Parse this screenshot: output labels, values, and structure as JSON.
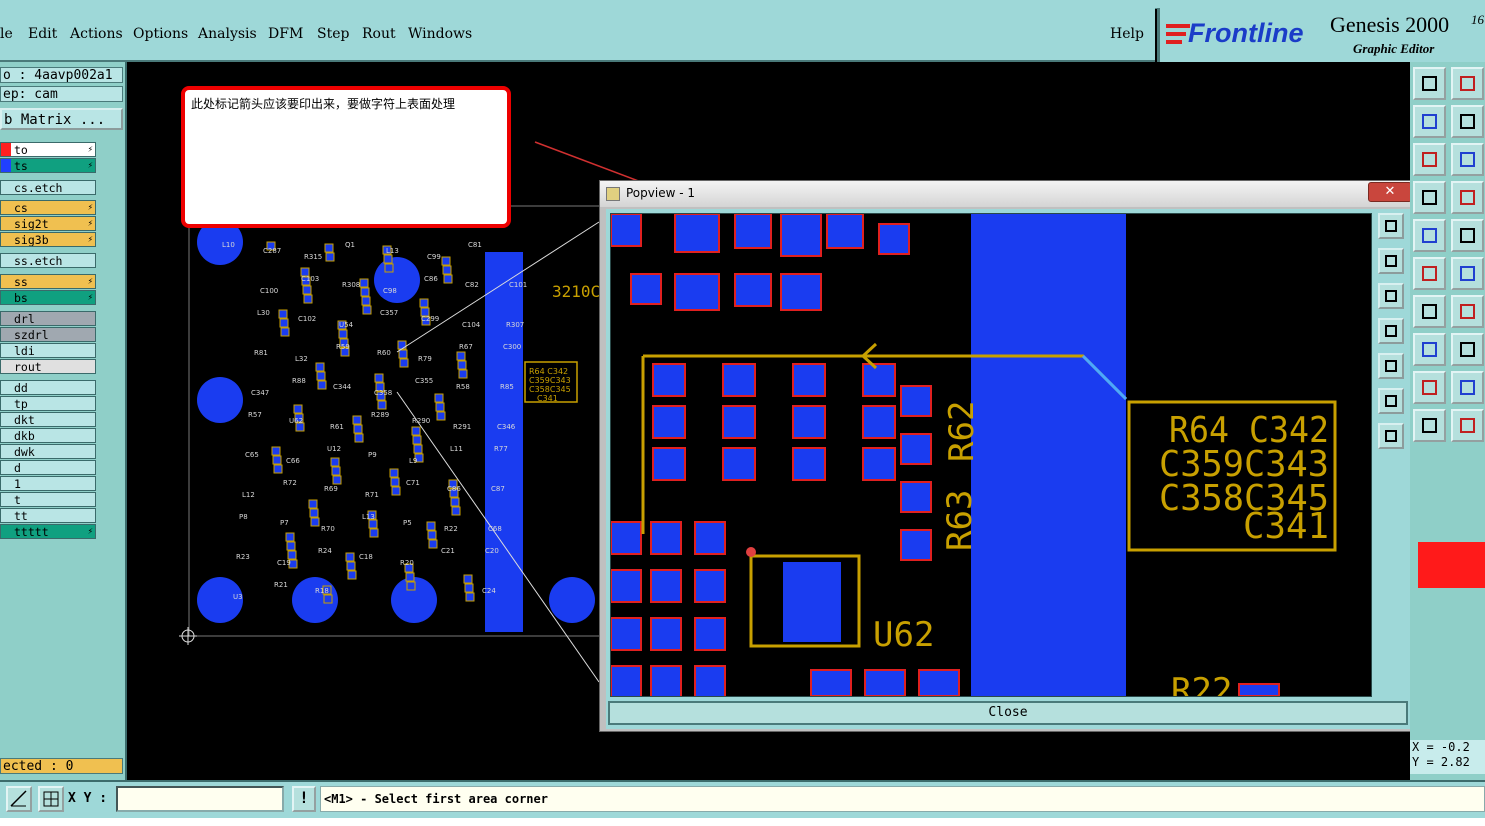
{
  "menu": {
    "items": [
      "le",
      "Edit",
      "Actions",
      "Options",
      "Analysis",
      "DFM",
      "Step",
      "Rout",
      "Windows"
    ],
    "help": "Help"
  },
  "logo": {
    "brand": "Frontline",
    "product": "Genesis 2000",
    "version_fragment": "16",
    "subtitle": "Graphic Editor"
  },
  "sidebar": {
    "job": "o : 4aavp002a1",
    "step": "ep: cam",
    "matrix_button": "b Matrix ...",
    "layers": [
      {
        "name": "to",
        "color": "#ff2020",
        "bg": "#ffffff"
      },
      {
        "name": "ts",
        "color": "#2040ff",
        "bg": "#10a080"
      },
      {
        "name": "cs.etch",
        "color": "",
        "bg": "#b9e5e5"
      },
      {
        "name": "cs",
        "color": "",
        "bg": "#f0c050"
      },
      {
        "name": "sig2t",
        "color": "",
        "bg": "#f0c050"
      },
      {
        "name": "sig3b",
        "color": "",
        "bg": "#f0c050"
      },
      {
        "name": "ss.etch",
        "color": "",
        "bg": "#b9e5e5"
      },
      {
        "name": "ss",
        "color": "",
        "bg": "#f0c050"
      },
      {
        "name": "bs",
        "color": "",
        "bg": "#10a080"
      },
      {
        "name": "drl",
        "color": "",
        "bg": "#a0a8b0"
      },
      {
        "name": "szdrl",
        "color": "",
        "bg": "#a0a8b0"
      },
      {
        "name": "ldi",
        "color": "",
        "bg": "#b9e5e5"
      },
      {
        "name": "rout",
        "color": "",
        "bg": "#e0e0e0"
      },
      {
        "name": "dd",
        "color": "",
        "bg": "#b9e5e5"
      },
      {
        "name": "tp",
        "color": "",
        "bg": "#b9e5e5"
      },
      {
        "name": "dkt",
        "color": "",
        "bg": "#b9e5e5"
      },
      {
        "name": "dkb",
        "color": "",
        "bg": "#b9e5e5"
      },
      {
        "name": "dwk",
        "color": "",
        "bg": "#b9e5e5"
      },
      {
        "name": "d",
        "color": "",
        "bg": "#b9e5e5"
      },
      {
        "name": "1",
        "color": "",
        "bg": "#b9e5e5"
      },
      {
        "name": "t",
        "color": "",
        "bg": "#b9e5e5"
      },
      {
        "name": "tt",
        "color": "",
        "bg": "#b9e5e5"
      },
      {
        "name": "ttttt",
        "color": "",
        "bg": "#10a080"
      }
    ],
    "selected": "ected : 0"
  },
  "note": {
    "text": "此处标记箭头应该要印出来，要做字符上表面处理"
  },
  "board_labels": [
    "L10",
    "C287",
    "R315",
    "Q1",
    "L13",
    "C99",
    "C81",
    "C101",
    "C100",
    "C103",
    "R308",
    "C98",
    "C86",
    "C82",
    "R307",
    "L30",
    "C102",
    "U54",
    "C357",
    "C299",
    "C104",
    "C300",
    "R81",
    "L32",
    "R59",
    "R60",
    "R79",
    "R67",
    "R85",
    "C347",
    "R88",
    "C344",
    "C358",
    "C355",
    "R58",
    "C346",
    "R57",
    "U62",
    "R61",
    "R289",
    "R290",
    "R291",
    "R77",
    "C65",
    "C66",
    "U12",
    "P9",
    "L9",
    "L11",
    "C87",
    "L12",
    "R72",
    "R69",
    "R71",
    "C71",
    "C86",
    "C68",
    "P8",
    "P7",
    "R70",
    "L13",
    "P5",
    "R22",
    "C20",
    "R23",
    "C19",
    "R24",
    "C18",
    "R20",
    "C21",
    "C24",
    "U3",
    "R21",
    "R18"
  ],
  "board_silk": "3210C",
  "board_callout": [
    "R64 C342",
    "C359C343",
    "C358C345",
    "C341"
  ],
  "popview": {
    "title": "Popview - 1",
    "close_x": "✕",
    "close_label": "Close",
    "labels": {
      "r62": "R62",
      "r63": "R63",
      "u62": "U62",
      "callout": [
        "R64 C342",
        "C359C343",
        "C358C345",
        "C341"
      ],
      "bottom": "R22"
    }
  },
  "right_coords": {
    "x": "X = -0.2",
    "y": "Y = 2.82"
  },
  "statusbar": {
    "xy_label": "X Y :",
    "xy_value": "",
    "bang": "!",
    "prompt": "<M1> - Select first area corner"
  },
  "colors": {
    "panel": "#9ed8d8",
    "sidebar": "#8fcfc8",
    "copper": "#1a3cf0",
    "silk": "#c8a000",
    "mask": "#ff2020"
  }
}
